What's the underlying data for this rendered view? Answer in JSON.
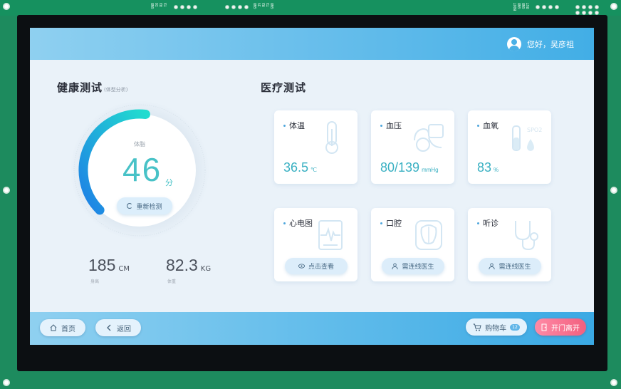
{
  "board": {
    "left_labels": [
      "GND",
      "IO",
      "RX",
      "TX"
    ],
    "mid_labels": [
      "GND",
      "3V",
      "RX",
      "TX",
      "GND"
    ],
    "right_labels": [
      "BOOT",
      "GND",
      "GND",
      "RST"
    ]
  },
  "header": {
    "greeting": "您好，吴彦祖"
  },
  "health": {
    "title": "健康测试",
    "subtitle": "(体型分析)",
    "score_label": "体脂",
    "score": "46",
    "score_unit": "分",
    "score_fraction": 0.46,
    "retest_label": "重新检测",
    "height_value": "185",
    "height_unit": "CM",
    "height_label": "身高",
    "weight_value": "82.3",
    "weight_unit": "KG",
    "weight_label": "体重"
  },
  "medical": {
    "title": "医疗测试",
    "cards": [
      {
        "name": "体温",
        "value": "36.5",
        "unit": "℃",
        "icon": "thermometer-icon"
      },
      {
        "name": "血压",
        "value": "80/139",
        "unit": "mmHg",
        "icon": "blood-pressure-icon"
      },
      {
        "name": "血氧",
        "value": "83",
        "unit": "%",
        "icon": "spo2-icon",
        "icon_text": "SPO2"
      },
      {
        "name": "心电图",
        "button": "点击查看",
        "icon": "ecg-icon"
      },
      {
        "name": "口腔",
        "button": "需连线医生",
        "icon": "tooth-icon"
      },
      {
        "name": "听诊",
        "button": "需连线医生",
        "icon": "stethoscope-icon"
      }
    ]
  },
  "footer": {
    "home": "首页",
    "back": "返回",
    "cart": "购物车",
    "cart_count": "12",
    "exit": "开门离开"
  },
  "colors": {
    "accent": "#42aee6",
    "gauge_start": "#1e90e6",
    "gauge_end": "#22d8d0",
    "value": "#39b0c2",
    "exit": "#f2607f"
  }
}
